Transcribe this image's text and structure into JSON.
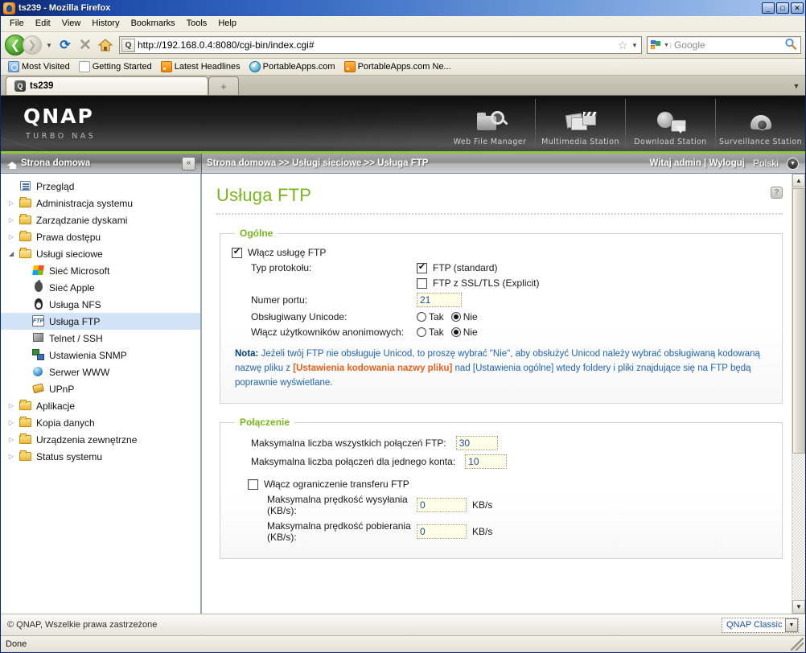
{
  "browser": {
    "window_title": "ts239 - Mozilla Firefox",
    "title_icon": "firefox-icon",
    "minimize": "_",
    "maximize": "□",
    "close": "✕",
    "menus": [
      "File",
      "Edit",
      "View",
      "History",
      "Bookmarks",
      "Tools",
      "Help"
    ],
    "nav": {
      "back_icon": "❮",
      "forward_icon": "❯",
      "history_dropdown_icon": "▼",
      "reload_icon": "⟳",
      "stop_icon": "✕",
      "home_icon": "home-icon"
    },
    "url": "http://192.168.0.4:8080/cgi-bin/index.cgi#",
    "url_site_icon": "Q",
    "star_icon": "☆",
    "url_dropdown_icon": "▼",
    "search": {
      "engine": "Google",
      "placeholder": "Google",
      "dropdown_icon": "▼",
      "magnifier_icon": "🔍"
    },
    "bookmarks": [
      {
        "label": "Most Visited",
        "icon": "folder-search-icon"
      },
      {
        "label": "Getting Started",
        "icon": "page-icon"
      },
      {
        "label": "Latest Headlines",
        "icon": "rss-icon"
      },
      {
        "label": "PortableApps.com",
        "icon": "check-circle-icon"
      },
      {
        "label": "PortableApps.com Ne...",
        "icon": "rss-icon"
      }
    ],
    "tabs": [
      {
        "label": "ts239",
        "icon": "qnap-favicon",
        "active": true
      },
      {
        "label": "+",
        "icon": "new-tab-icon",
        "active": false
      }
    ],
    "tabstrip_menu_icon": "▼",
    "status_text": "Done"
  },
  "qnap": {
    "logo": "QNAP",
    "tagline": "TURBO NAS",
    "stations": [
      {
        "label": "Web File Manager",
        "icon": "web-file-manager-icon"
      },
      {
        "label": "Multimedia Station",
        "icon": "multimedia-station-icon"
      },
      {
        "label": "Download Station",
        "icon": "download-station-icon"
      },
      {
        "label": "Surveillance Station",
        "icon": "surveillance-station-icon"
      }
    ],
    "accent_green": "#8dc63f",
    "title_green": "#7ab51d",
    "crumb": {
      "home_label": "Strona domowa",
      "home_icon": "home-icon",
      "collapse_icon": "«",
      "path": "Strona domowa >> Usługi sieciowe >> Usługa FTP",
      "welcome": "Witaj admin | Wyloguj",
      "language": "Polski",
      "language_dropdown_icon": "▼"
    },
    "sidebar": [
      {
        "label": "Przegląd",
        "icon": "overview-icon",
        "twisty": "",
        "depth": 0,
        "selected": false
      },
      {
        "label": "Administracja systemu",
        "icon": "folder-icon",
        "twisty": "▷",
        "depth": 0,
        "selected": false
      },
      {
        "label": "Zarządzanie dyskami",
        "icon": "folder-icon",
        "twisty": "▷",
        "depth": 0,
        "selected": false
      },
      {
        "label": "Prawa dostępu",
        "icon": "folder-icon",
        "twisty": "▷",
        "depth": 0,
        "selected": false
      },
      {
        "label": "Usługi sieciowe",
        "icon": "folder-open-icon",
        "twisty": "◢",
        "depth": 0,
        "selected": false
      },
      {
        "label": "Sieć Microsoft",
        "icon": "microsoft-icon",
        "twisty": "",
        "depth": 1,
        "selected": false
      },
      {
        "label": "Sieć Apple",
        "icon": "apple-icon",
        "twisty": "",
        "depth": 1,
        "selected": false
      },
      {
        "label": "Usługa NFS",
        "icon": "linux-penguin-icon",
        "twisty": "",
        "depth": 1,
        "selected": false
      },
      {
        "label": "Usługa FTP",
        "icon": "ftp-icon",
        "twisty": "",
        "depth": 1,
        "selected": true
      },
      {
        "label": "Telnet / SSH",
        "icon": "telnet-icon",
        "twisty": "",
        "depth": 1,
        "selected": false
      },
      {
        "label": "Ustawienia SNMP",
        "icon": "snmp-icon",
        "twisty": "",
        "depth": 1,
        "selected": false
      },
      {
        "label": "Serwer WWW",
        "icon": "globe-icon",
        "twisty": "",
        "depth": 1,
        "selected": false
      },
      {
        "label": "UPnP",
        "icon": "upnp-icon",
        "twisty": "",
        "depth": 1,
        "selected": false
      },
      {
        "label": "Aplikacje",
        "icon": "folder-icon",
        "twisty": "▷",
        "depth": 0,
        "selected": false
      },
      {
        "label": "Kopia danych",
        "icon": "folder-icon",
        "twisty": "▷",
        "depth": 0,
        "selected": false
      },
      {
        "label": "Urządzenia zewnętrzne",
        "icon": "folder-icon",
        "twisty": "▷",
        "depth": 0,
        "selected": false
      },
      {
        "label": "Status systemu",
        "icon": "folder-icon",
        "twisty": "▷",
        "depth": 0,
        "selected": false
      }
    ],
    "content": {
      "title": "Usługa FTP",
      "help_icon": "?",
      "general": {
        "legend": "Ogólne",
        "enable_ftp_label": "Włącz usługę FTP",
        "enable_ftp_checked": true,
        "protocol_label": "Typ protokołu:",
        "protocol_options": [
          {
            "label": "FTP (standard)",
            "checked": true
          },
          {
            "label": "FTP z SSL/TLS (Explicit)",
            "checked": false
          }
        ],
        "port_label": "Numer portu:",
        "port_value": "21",
        "unicode_label": "Obsługiwany Unicode:",
        "unicode_yes": "Tak",
        "unicode_no": "Nie",
        "unicode_selected": "Nie",
        "anonymous_label": "Włącz użytkowników anonimowych:",
        "anonymous_yes": "Tak",
        "anonymous_no": "Nie",
        "anonymous_selected": "Nie",
        "note_prefix": "Nota:",
        "note_part1": " Jeżeli twój FTP nie obsługuje Unicod, to proszę wybrać \"Nie\", aby obsłużyć Unicod należy wybrać obsługiwaną kodowaną nazwę pliku z ",
        "note_link": "[Ustawienia kodowania nazwy pliku]",
        "note_part2": " nad [Ustawienia ogólne] wtedy foldery i pliki znajdujące się na FTP będą poprawnie wyświetlane."
      },
      "connection": {
        "legend": "Połączenie",
        "max_all_label": "Maksymalna liczba wszystkich połączeń FTP:",
        "max_all_value": "30",
        "max_per_account_label": "Maksymalna liczba połączeń dla jednego konta:",
        "max_per_account_value": "10",
        "enable_limit_label": "Włącz ograniczenie transferu FTP",
        "enable_limit_checked": false,
        "upload_label": "Maksymalna prędkość wysyłania (KB/s):",
        "upload_value": "0",
        "upload_unit": "KB/s",
        "download_label": "Maksymalna prędkość pobierania (KB/s):",
        "download_value": "0",
        "download_unit": "KB/s"
      }
    },
    "footer": {
      "copyright": "© QNAP, Wszelkie prawa zastrzeżone",
      "theme": "QNAP Classic",
      "theme_dropdown_icon": "▼"
    },
    "scrollbar": {
      "up_icon": "▲",
      "down_icon": "▼"
    }
  }
}
